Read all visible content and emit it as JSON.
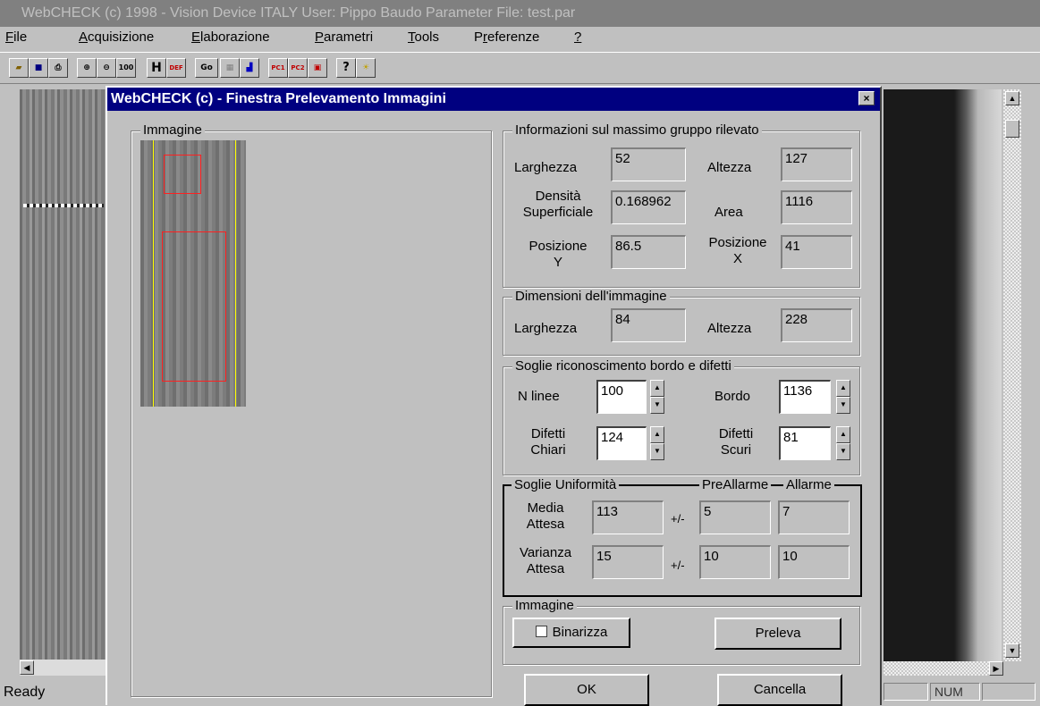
{
  "app": {
    "title": "WebCHECK (c) 1998 - Vision Device ITALY   User: Pippo Baudo   Parameter File: test.par"
  },
  "menu": {
    "file": {
      "u": "F",
      "rest": "ile"
    },
    "acquisizione": {
      "u": "A",
      "rest": "cquisizione"
    },
    "elaborazione": {
      "u": "E",
      "rest": "laborazione"
    },
    "parametri": {
      "u": "P",
      "rest": "arametri"
    },
    "tools": {
      "u": "T",
      "rest": "ools"
    },
    "preferenze": {
      "pre": "P",
      "u": "r",
      "rest": "eferenze"
    },
    "help": {
      "u": "?"
    }
  },
  "toolbar": {
    "icons": [
      "open-icon",
      "save-icon",
      "print-icon",
      "zoom-in-icon",
      "zoom-out-icon",
      "zoom-100-icon",
      "film-icon",
      "def-icon",
      "go-icon",
      "st-icon",
      "chart-icon",
      "pc1-icon",
      "pc2-icon",
      "calc-icon",
      "help-icon",
      "info-icon"
    ],
    "labels": {
      "zoom100": "100",
      "def": "DEF",
      "go": "Go",
      "pc1": "PC1",
      "pc2": "PC2",
      "help": "?"
    }
  },
  "status": {
    "text": "Ready",
    "num": "NUM"
  },
  "dialog": {
    "title": "WebCHECK (c) - Finestra Prelevamento Immagini",
    "close": "×",
    "image_group": "Immagine",
    "max_group": {
      "legend": "Informazioni sul massimo gruppo rilevato",
      "larghezza_label": "Larghezza",
      "larghezza": "52",
      "altezza_label": "Altezza",
      "altezza": "127",
      "densita_label_1": "Densità",
      "densita_label_2": "Superficiale",
      "densita": "0.168962",
      "area_label": "Area",
      "area": "1116",
      "posy_label_1": "Posizione",
      "posy_label_2": "Y",
      "posy": "86.5",
      "posx_label_1": "Posizione",
      "posx_label_2": "X",
      "posx": "41"
    },
    "dim_group": {
      "legend": "Dimensioni dell'immagine",
      "larghezza_label": "Larghezza",
      "larghezza": "84",
      "altezza_label": "Altezza",
      "altezza": "228"
    },
    "soglie_group": {
      "legend": "Soglie riconoscimento bordo e difetti",
      "nlinee_label": "N linee",
      "nlinee": "100",
      "bordo_label": "Bordo",
      "bordo": "1136",
      "chiari_label_1": "Difetti",
      "chiari_label_2": "Chiari",
      "chiari": "124",
      "scuri_label_1": "Difetti",
      "scuri_label_2": "Scuri",
      "scuri": "81"
    },
    "uniform_group": {
      "legend": "Soglie Uniformità",
      "prealarm_label": "PreAllarme",
      "alarm_label": "Allarme",
      "media_label_1": "Media",
      "media_label_2": "Attesa",
      "media": "113",
      "pm1": "+/-",
      "media_pre": "5",
      "media_alarm": "7",
      "var_label_1": "Varianza",
      "var_label_2": "Attesa",
      "varianza": "15",
      "pm2": "+/-",
      "var_pre": "10",
      "var_alarm": "10"
    },
    "image2_group": {
      "legend": "Immagine",
      "binarizza_label": "Binarizza",
      "binarizza_checked": false,
      "preleva_label": "Preleva"
    },
    "ok_label": "OK",
    "cancel_label": "Cancella"
  }
}
